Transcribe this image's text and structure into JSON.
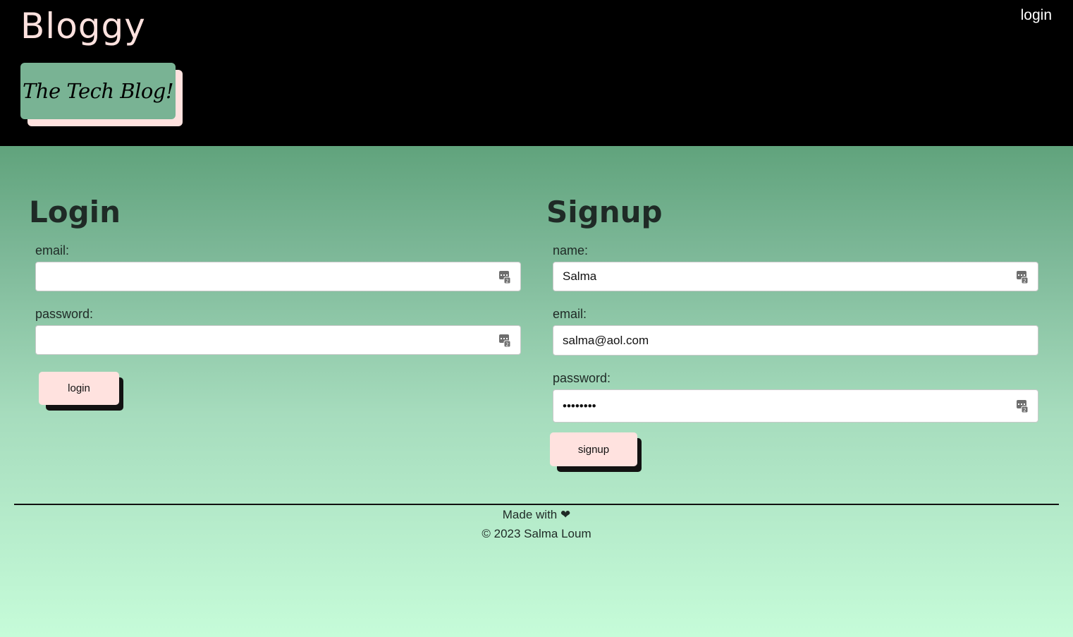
{
  "header": {
    "brand": "Bloggy",
    "nav_login": "login",
    "tagline": "The Tech Blog!"
  },
  "login": {
    "title": "Login",
    "email_label": "email:",
    "email_value": "",
    "password_label": "password:",
    "password_value": "",
    "button_label": "login"
  },
  "signup": {
    "title": "Signup",
    "name_label": "name:",
    "name_value": "Salma",
    "email_label": "email:",
    "email_value": "salma@aol.com",
    "password_label": "password:",
    "password_value": "••••••••",
    "button_label": "signup"
  },
  "footer": {
    "made_with": "Made with ❤",
    "copyright": "© 2023 Salma Loum"
  },
  "icons": {
    "autofill": "password-manager-key-icon"
  },
  "colors": {
    "header_bg": "#000000",
    "brand": "#ffe2df",
    "tagline_bg": "#79b394",
    "button_bg": "#ffe2df",
    "gradient_top": "#3a8757",
    "gradient_bottom": "#c6fcd9"
  }
}
